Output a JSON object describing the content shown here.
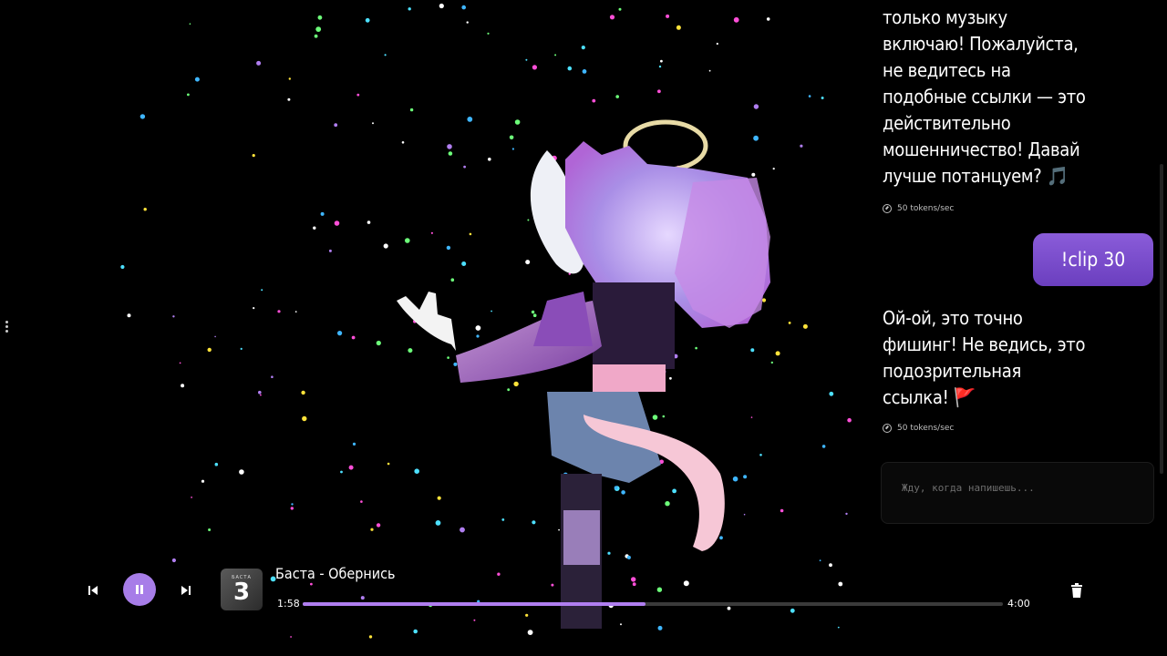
{
  "chat": {
    "messages": [
      {
        "role": "assistant",
        "text": "только музыку включаю! Пожалуйста, не ведитесь на подобные ссылки — это действительно мошенничество! Давай лучше потанцуем? 🎵",
        "speed": "50 tokens/sec"
      },
      {
        "role": "user",
        "text": "!clip 30"
      },
      {
        "role": "assistant",
        "text": "Ой-ой, это точно фишинг! Не ведись, это подозрительная ссылка! 🚩",
        "speed": "50 tokens/sec"
      }
    ],
    "input_placeholder": "Жду, когда напишешь..."
  },
  "player": {
    "track_title": "Баста - Обернись",
    "current_time": "1:58",
    "total_time": "4:00",
    "progress": 0.49,
    "cover_text_small": "БАСТА",
    "cover_text_big": "3",
    "accent_color": "#a77de8",
    "icons": [
      "previous-icon",
      "pause-icon",
      "next-icon",
      "trash-icon"
    ]
  }
}
